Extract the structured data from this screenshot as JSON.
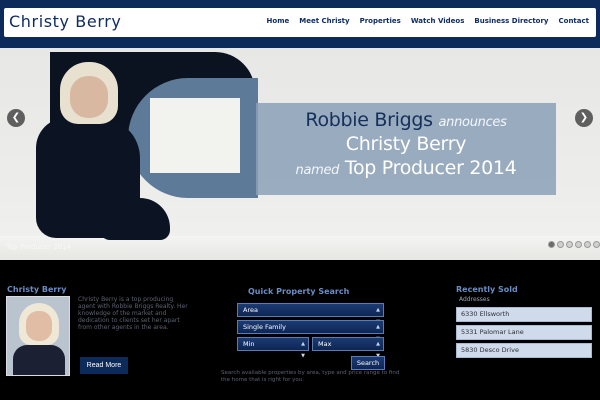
{
  "brand": "Christy Berry",
  "nav": [
    "Home",
    "Meet Christy",
    "Properties",
    "Watch Videos",
    "Business Directory",
    "Contact"
  ],
  "hero": {
    "line1_name": "Robbie Briggs",
    "line1_verb": "announces",
    "line2": "Christy Berry",
    "line3_prefix": "named",
    "line3_title": "Top Producer 2014",
    "caption": "Top Producer 2014",
    "prev_icon": "chevron-left-icon",
    "next_icon": "chevron-right-icon",
    "slides_total": 6,
    "slide_active": 1
  },
  "about": {
    "title": "Christy Berry",
    "text": "Christy Berry is a top producing agent with Robbie Briggs Realty. Her knowledge of the market and dedication to clients set her apart from other agents in the area.",
    "read_more": "Read More"
  },
  "search": {
    "title": "Quick Property Search",
    "area": "Area",
    "type": "Single Family",
    "min": "Min",
    "max": "Max",
    "button": "Search",
    "note": "Search available properties by area, type and price range to find the home that is right for you."
  },
  "recent": {
    "title": "Recently Sold",
    "label": "Addresses",
    "addresses": [
      "6330 Ellsworth",
      "5331 Palomar Lane",
      "5830 Desco Drive"
    ]
  },
  "colors": {
    "navy": "#0c2a5a",
    "accent": "#6a8cc4",
    "overlay": "#8ba0b7"
  }
}
